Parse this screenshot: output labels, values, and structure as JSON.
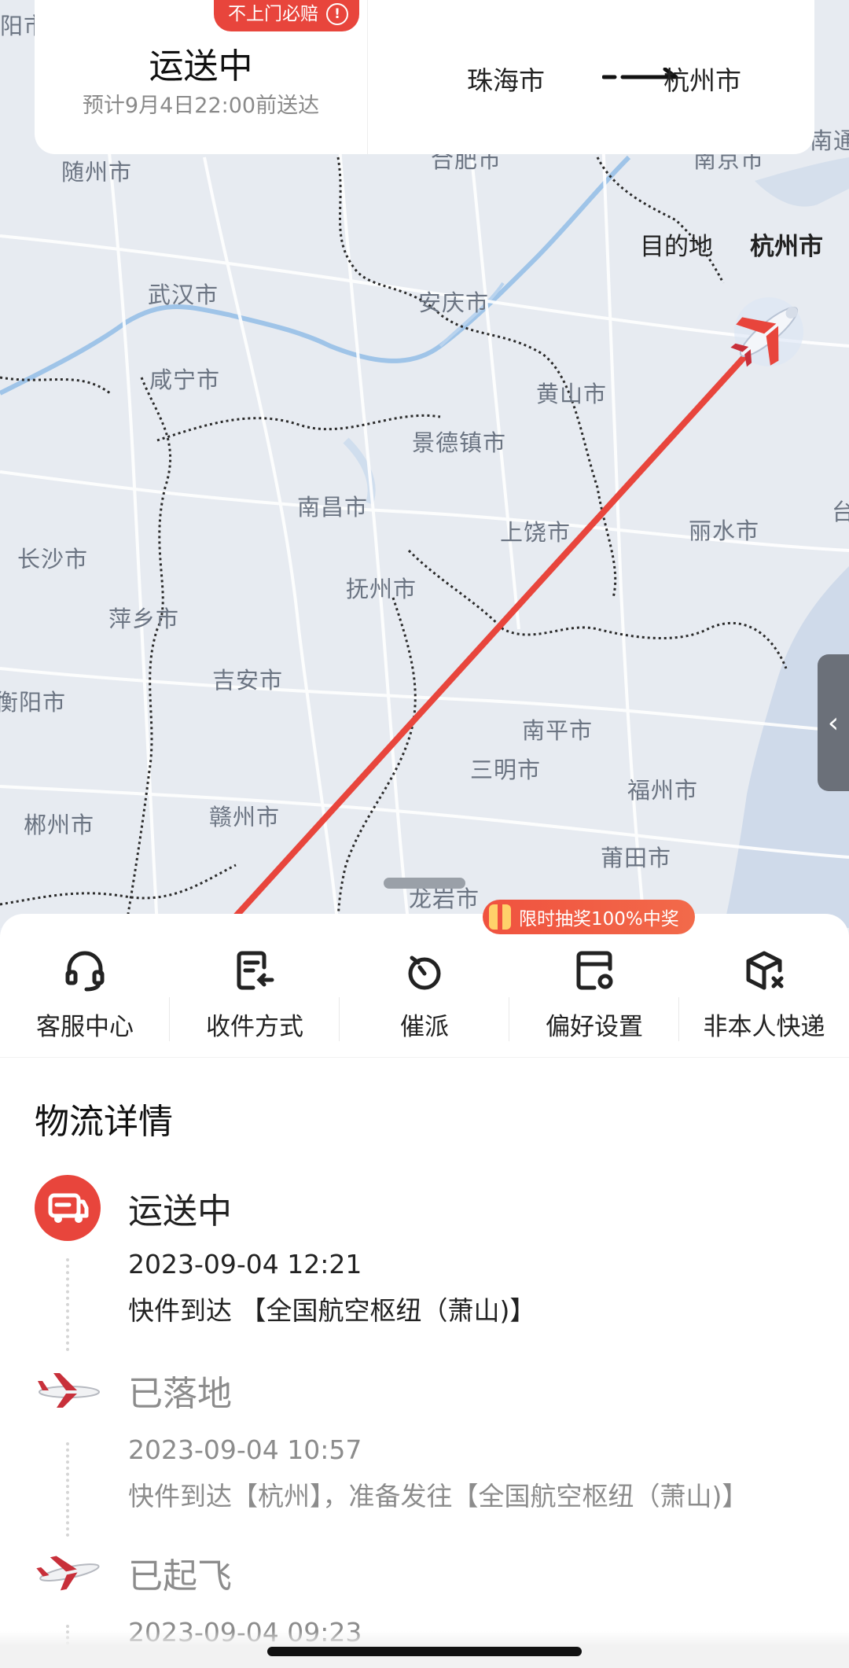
{
  "map": {
    "cities": [
      "阳市",
      "随州市",
      "合肥市",
      "南京市",
      "南通市",
      "武汉市",
      "安庆市",
      "咸宁市",
      "黄山市",
      "景德镇市",
      "南昌市",
      "上饶市",
      "丽水市",
      "长沙市",
      "抚州市",
      "萍乡市",
      "吉安市",
      "衡阳市",
      "南平市",
      "三明市",
      "福州市",
      "郴州市",
      "赣州市",
      "莆田市",
      "龙岩市",
      "台"
    ],
    "destination_prefix": "目的地",
    "destination_city": "杭州市",
    "route_color": "#e8453c"
  },
  "top_card": {
    "badge": "不上门必赔",
    "badge_icon": "info-icon",
    "status": "运送中",
    "eta": "预计9月4日22:00前送达",
    "from_city": "珠海市",
    "to_city": "杭州市"
  },
  "side_handle": {
    "icon": "chevron-left-icon",
    "glyph": "‹"
  },
  "promo": {
    "label": "限时抽奖100%中奖"
  },
  "actions": [
    {
      "label": "客服中心",
      "icon": "headset-icon"
    },
    {
      "label": "收件方式",
      "icon": "receive-method-icon"
    },
    {
      "label": "催派",
      "icon": "stopwatch-icon"
    },
    {
      "label": "偏好设置",
      "icon": "preference-icon"
    },
    {
      "label": "非本人快递",
      "icon": "package-x-icon"
    }
  ],
  "details": {
    "title": "物流详情",
    "items": [
      {
        "status": "运送中",
        "time": "2023-09-04 12:21",
        "desc": "快件到达 【全国航空枢纽（萧山)】",
        "icon": "truck-icon"
      },
      {
        "status": "已落地",
        "time": "2023-09-04 10:57",
        "desc": "快件到达【杭州】，准备发往【全国航空枢纽（萧山)】",
        "icon": "airplane-landed-icon"
      },
      {
        "status": "已起飞",
        "time": "2023-09-04 09:23",
        "desc": "",
        "icon": "airplane-takeoff-icon"
      }
    ]
  },
  "colors": {
    "accent": "#e8453c",
    "text": "#222222",
    "muted": "#8c8c8c"
  }
}
